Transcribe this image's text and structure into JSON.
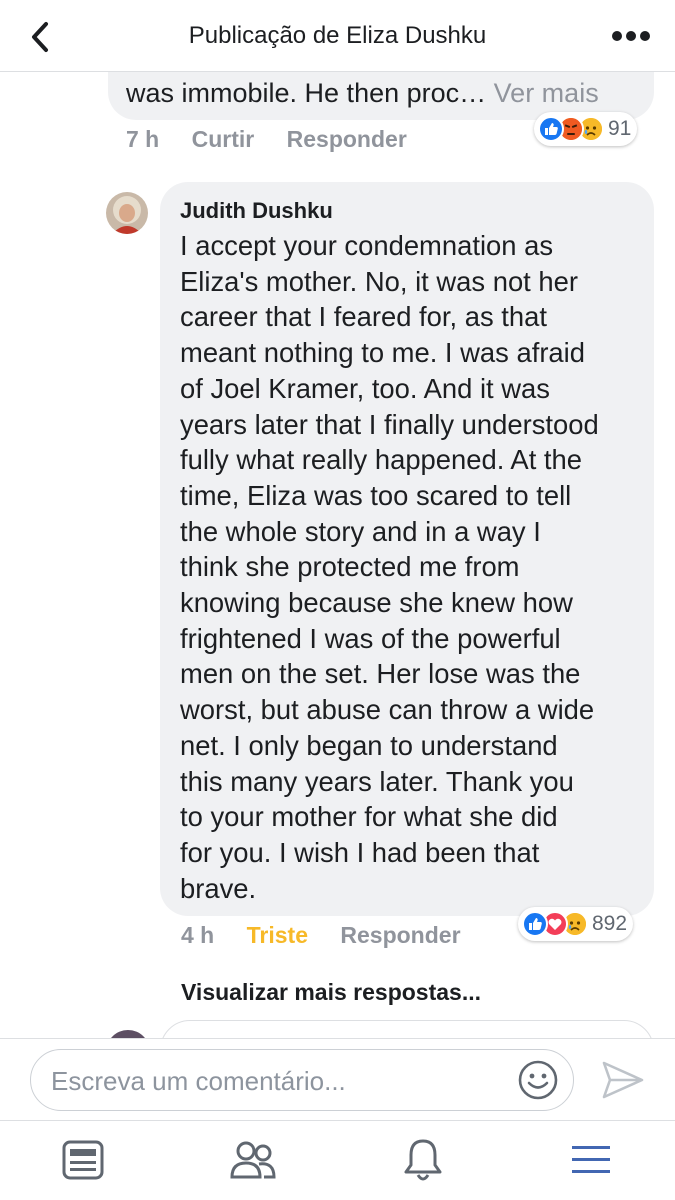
{
  "header": {
    "title": "Publicação de Eliza Dushku"
  },
  "previous_comment": {
    "text_tail": "was immobile. He then proc…",
    "see_more": "Ver mais",
    "time": "7 h",
    "like_label": "Curtir",
    "reply_label": "Responder",
    "reactions": [
      "like",
      "angry",
      "sad"
    ],
    "reaction_count": "91"
  },
  "comment": {
    "author": "Judith Dushku",
    "lines": [
      "I accept your condemnation as",
      "Eliza's mother.  No, it was not her",
      "career that I feared for, as that",
      "meant nothing to me.  I was afraid",
      "of Joel Kramer, too.  And it was",
      "years later that I finally understood",
      "fully what really happened. At the",
      "time, Eliza was too scared to tell",
      "the whole story and in a way I",
      "think she protected me from",
      "knowing because she knew how",
      "frightened I was of the powerful",
      "men on the set.  Her lose was the",
      "worst, but abuse can throw a wide",
      "net.  I only began to understand",
      "this many years later.  Thank you",
      "to your mother for what she did",
      "for you.  I wish I had been that",
      "brave."
    ],
    "time": "4 h",
    "reacted_label": "Triste",
    "reply_label": "Responder",
    "reactions": [
      "like",
      "love",
      "sad"
    ],
    "reaction_count": "892"
  },
  "more_replies": "Visualizar mais respostas...",
  "input": {
    "placeholder": "Escreva um comentário..."
  },
  "tabs": [
    "news-feed",
    "friends",
    "notifications",
    "menu"
  ],
  "colors": {
    "facebook_blue": "#4267b2",
    "reaction_like": "#1877f2",
    "reaction_love": "#f33e58",
    "reaction_sad": "#f7b928",
    "bubble_bg": "#f0f1f3",
    "meta_gray": "#90949c"
  }
}
